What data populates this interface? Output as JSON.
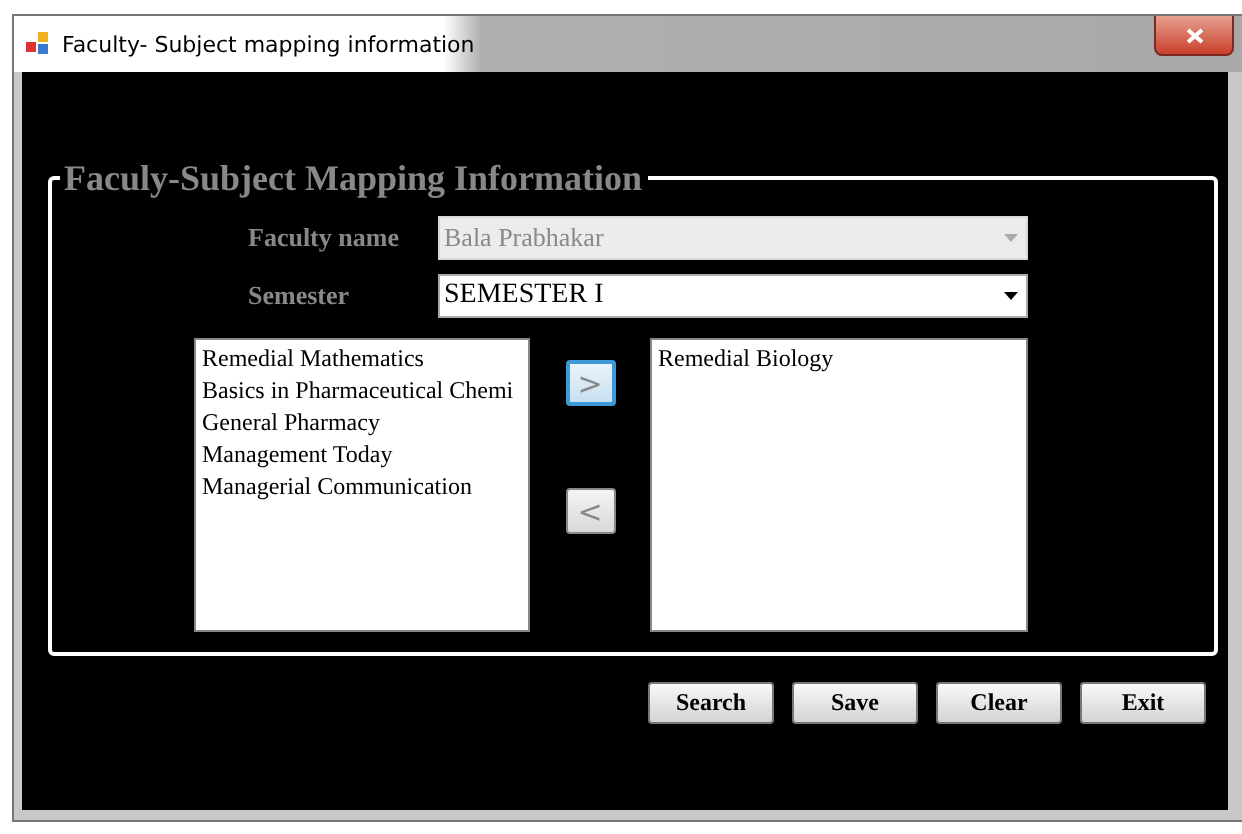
{
  "window": {
    "title": "Faculty- Subject mapping information"
  },
  "group": {
    "title": "Faculy-Subject Mapping Information"
  },
  "fields": [
    {
      "label": "Faculty name",
      "value": "Bala Prabhakar",
      "disabled": true
    },
    {
      "label": "Semester",
      "value": "SEMESTER I",
      "disabled": false
    }
  ],
  "available_subjects": [
    "Remedial Mathematics",
    "Basics in Pharmaceutical Chemi",
    "General Pharmacy",
    "Management Today",
    "Managerial Communication"
  ],
  "move_buttons": [
    {
      "label": ">",
      "focused": true
    },
    {
      "label": "<",
      "focused": false
    }
  ],
  "assigned_subjects": [
    "Remedial Biology"
  ],
  "buttons": [
    "Search",
    "Save",
    "Clear",
    "Exit"
  ]
}
